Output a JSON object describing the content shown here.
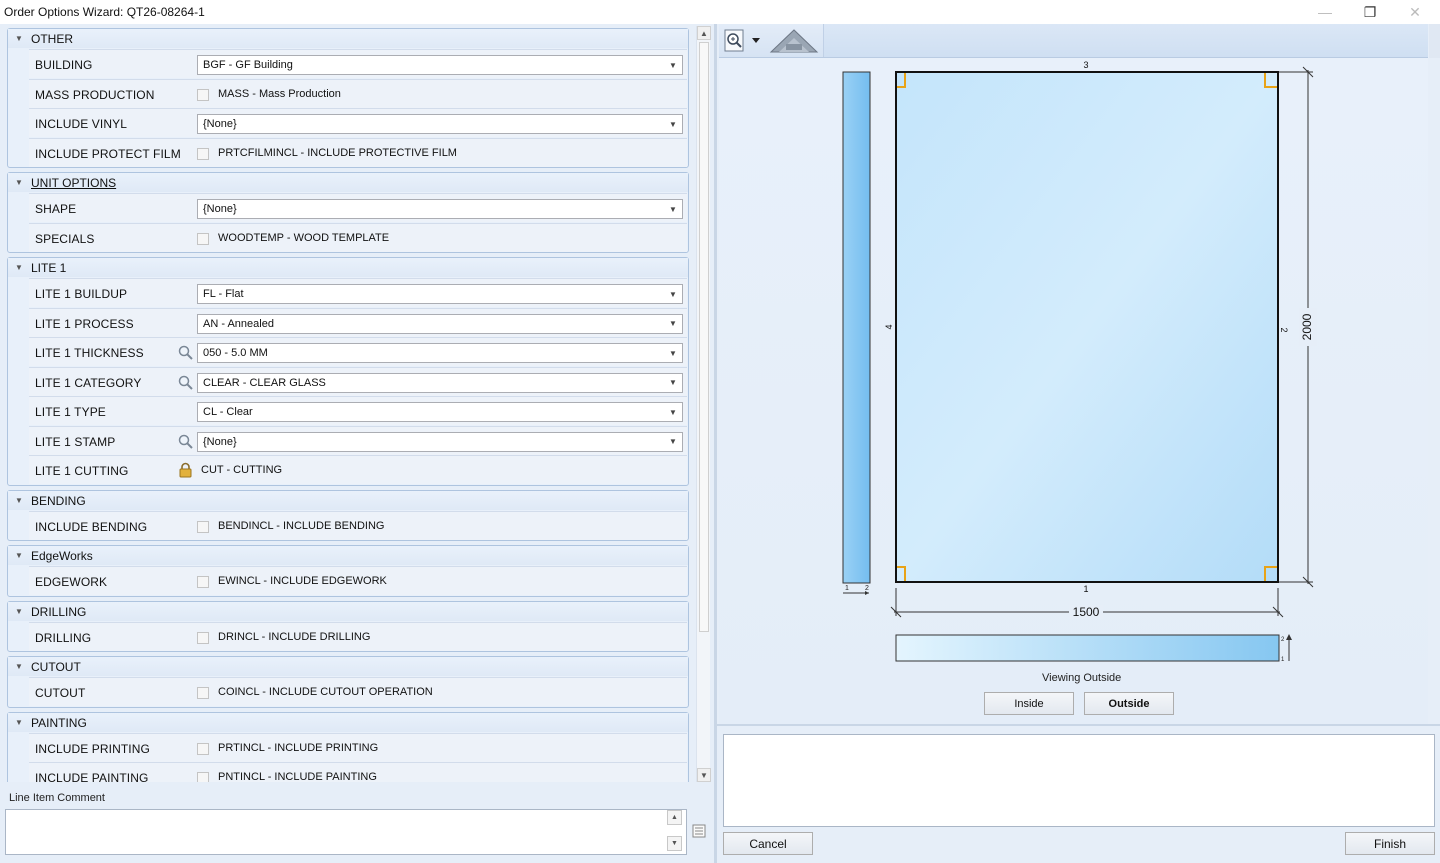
{
  "window": {
    "title": "Order Options Wizard: QT26-08264-1",
    "min_glyph": "—",
    "max_glyph": "❐",
    "close_glyph": "✕"
  },
  "groups": [
    {
      "name": "OTHER",
      "underline": false,
      "rows": [
        {
          "label": "BUILDING",
          "kind": "combo",
          "value": "BGF - GF Building"
        },
        {
          "label": "MASS PRODUCTION",
          "kind": "check",
          "value": "MASS - Mass Production"
        },
        {
          "label": "INCLUDE VINYL",
          "kind": "combo",
          "value": "{None}"
        },
        {
          "label": "INCLUDE PROTECT FILM",
          "kind": "check",
          "value": "PRTCFILMINCL - INCLUDE PROTECTIVE FILM"
        }
      ]
    },
    {
      "name": "UNIT OPTIONS",
      "underline": true,
      "rows": [
        {
          "label": "SHAPE",
          "kind": "combo",
          "value": "{None}"
        },
        {
          "label": "SPECIALS",
          "kind": "check",
          "value": "WOODTEMP - WOOD TEMPLATE"
        }
      ]
    },
    {
      "name": "LITE 1",
      "underline": false,
      "rows": [
        {
          "label": "LITE 1 BUILDUP",
          "kind": "combo",
          "value": "FL - Flat"
        },
        {
          "label": "LITE 1 PROCESS",
          "kind": "combo",
          "value": "AN - Annealed"
        },
        {
          "label": "LITE 1 THICKNESS",
          "kind": "combo",
          "value": "050 - 5.0 MM",
          "search": true
        },
        {
          "label": "LITE 1 CATEGORY",
          "kind": "combo",
          "value": "CLEAR - CLEAR GLASS",
          "search": true
        },
        {
          "label": "LITE 1 TYPE",
          "kind": "combo",
          "value": "CL - Clear"
        },
        {
          "label": "LITE 1 STAMP",
          "kind": "combo",
          "value": "{None}",
          "search": true
        },
        {
          "label": "LITE 1 CUTTING",
          "kind": "locked",
          "value": "CUT - CUTTING"
        }
      ]
    },
    {
      "name": "BENDING",
      "underline": false,
      "rows": [
        {
          "label": "INCLUDE BENDING",
          "kind": "check",
          "value": "BENDINCL - INCLUDE BENDING"
        }
      ]
    },
    {
      "name": "EdgeWorks",
      "underline": false,
      "rows": [
        {
          "label": "EDGEWORK",
          "kind": "check",
          "value": "EWINCL - INCLUDE EDGEWORK"
        }
      ]
    },
    {
      "name": "DRILLING",
      "underline": false,
      "rows": [
        {
          "label": "DRILLING",
          "kind": "check",
          "value": "DRINCL - INCLUDE DRILLING"
        }
      ]
    },
    {
      "name": "CUTOUT",
      "underline": false,
      "rows": [
        {
          "label": "CUTOUT",
          "kind": "check",
          "value": "COINCL - INCLUDE CUTOUT OPERATION"
        }
      ]
    },
    {
      "name": "PAINTING",
      "underline": false,
      "rows": [
        {
          "label": "INCLUDE PRINTING",
          "kind": "check",
          "value": "PRTINCL - INCLUDE PRINTING"
        },
        {
          "label": "INCLUDE PAINTING",
          "kind": "check",
          "value": "PNTINCL - INCLUDE PAINTING"
        }
      ]
    }
  ],
  "comment": {
    "label": "Line Item Comment",
    "value": ""
  },
  "preview": {
    "width_label": "1500",
    "height_label": "2000",
    "edge_top": "3",
    "edge_right": "2",
    "edge_bottom": "1",
    "edge_left": "4",
    "side_label_1": "1",
    "side_label_2": "2",
    "thick_label_top": "2",
    "thick_label_bottom": "1",
    "viewing_text": "Viewing Outside",
    "inside_button": "Inside",
    "outside_button": "Outside"
  },
  "footer": {
    "cancel_button": "Cancel",
    "finish_button": "Finish"
  },
  "colors": {
    "glass_light": "#dff0fd",
    "glass_dark": "#86c7f1",
    "corner_marker": "#e8a317",
    "group_border": "#aec4df"
  },
  "icons": [
    "zoom-icon",
    "dropdown-arrow-icon",
    "shape-template-icon",
    "search-icon",
    "lock-icon",
    "notes-icon"
  ]
}
